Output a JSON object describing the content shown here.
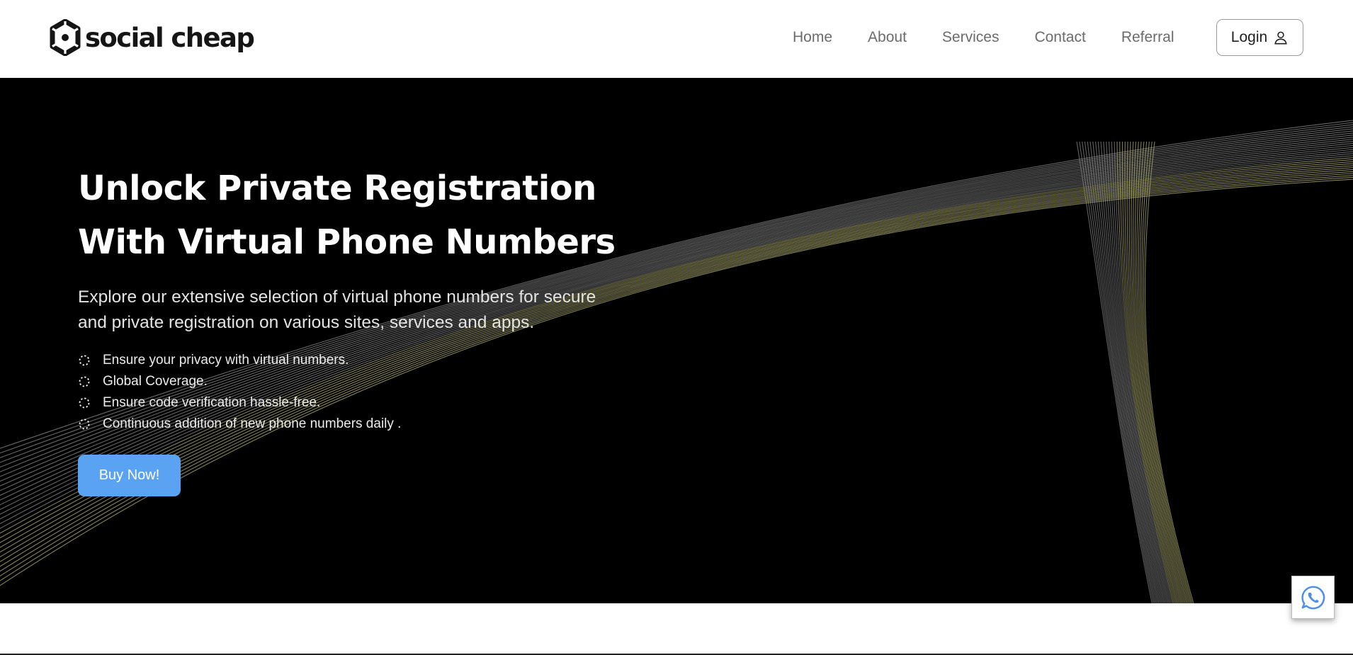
{
  "header": {
    "logo_text": "social cheap",
    "logo_icon": "hexagon-swirl-logo",
    "nav": [
      {
        "label": "Home"
      },
      {
        "label": "About"
      },
      {
        "label": "Services"
      },
      {
        "label": "Contact"
      },
      {
        "label": "Referral"
      }
    ],
    "login_label": "Login",
    "login_icon": "user-icon"
  },
  "hero": {
    "title_line1": "Unlock Private Registration",
    "title_line2": "With Virtual Phone Numbers",
    "subtitle_line1": "Explore our extensive selection of virtual phone numbers for secure",
    "subtitle_line2": "and private registration on various sites, services and apps.",
    "features": [
      {
        "text": "Ensure your privacy with virtual numbers."
      },
      {
        "text": "Global Coverage."
      },
      {
        "text": "Ensure code verification hassle-free."
      },
      {
        "text": "Continuous addition of new phone numbers daily ."
      }
    ],
    "feature_icon": "dashed-circle-icon",
    "cta_label": "Buy Now!",
    "background": "wave-lines"
  },
  "floating": {
    "icon": "whatsapp-icon"
  },
  "colors": {
    "hero_bg": "#000000",
    "cta": "#5aa2f2",
    "wave_left": "#8a8a8a",
    "wave_right": "#b3b074",
    "nav_text": "#6b6b6b"
  }
}
